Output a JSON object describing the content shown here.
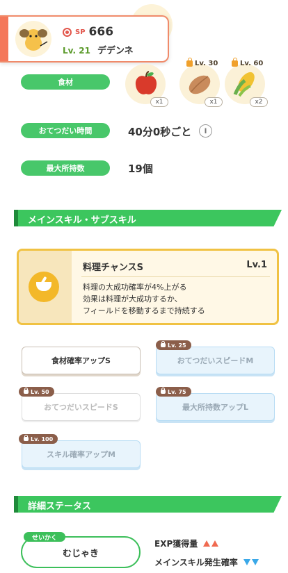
{
  "header": {
    "sp_label": "SP",
    "sp_value": "666",
    "level": "Lv. 21",
    "pokemon_name": "デデンネ"
  },
  "ingredients": {
    "label": "食材",
    "items": [
      {
        "count": "x1",
        "unlock_level": "",
        "color": "#d93a2b"
      },
      {
        "count": "x1",
        "unlock_level": "Lv. 30",
        "color": "#c98b5c"
      },
      {
        "count": "x2",
        "unlock_level": "Lv. 60",
        "color": "#f1c232"
      }
    ]
  },
  "help_time": {
    "label": "おてつだい時間",
    "value": "40分0秒ごと",
    "info_icon": "i"
  },
  "max_carry": {
    "label": "最大所持数",
    "value": "19個"
  },
  "sections": {
    "skills": "メインスキル・サブスキル",
    "details": "詳細ステータス"
  },
  "main_skill": {
    "name": "料理チャンスS",
    "level": "Lv.1",
    "description": "料理の大成功確率が4%上がる\n効果は料理が大成功するか、\nフィールドを移動するまで持続する"
  },
  "sub_skills": [
    {
      "label": "食材確率アップS",
      "unlock_level": ""
    },
    {
      "label": "おてつだいスピードM",
      "unlock_level": "Lv. 25"
    },
    {
      "label": "おてつだいスピードS",
      "unlock_level": "Lv. 50"
    },
    {
      "label": "最大所持数アップL",
      "unlock_level": "Lv. 75"
    },
    {
      "label": "スキル確率アップM",
      "unlock_level": "Lv. 100"
    }
  ],
  "nature": {
    "tag": "せいかく",
    "value": "むじゃき"
  },
  "stats": [
    {
      "label": "EXP獲得量",
      "direction": "up"
    },
    {
      "label": "メインスキル発生確率",
      "direction": "down"
    }
  ],
  "colors": {
    "accent_green": "#3cc65e",
    "header_orange": "#f4775a",
    "skill_gold": "#f0c243"
  }
}
